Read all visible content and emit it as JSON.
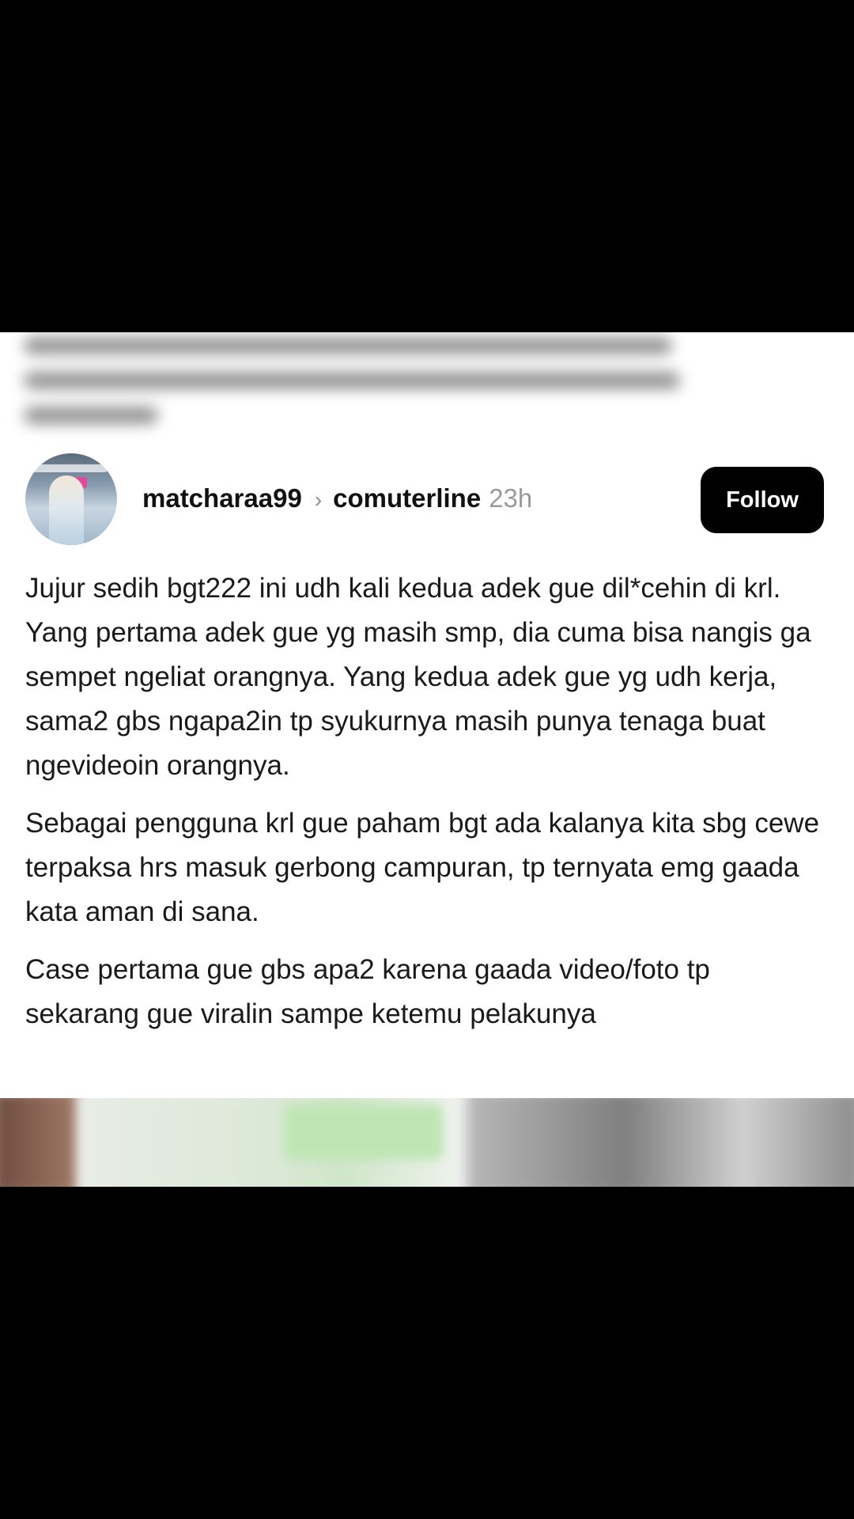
{
  "post": {
    "username": "matcharaa99",
    "separator": "›",
    "community": "comuterline",
    "time": "23h",
    "follow_label": "Follow",
    "paragraphs": [
      "Jujur sedih bgt222 ini udh kali kedua adek gue dil*cehin di krl. Yang pertama adek gue yg masih smp, dia cuma bisa nangis ga sempet ngeliat orangnya. Yang kedua adek gue yg udh kerja, sama2 gbs ngapa2in tp syukurnya masih punya tenaga buat ngevideoin orangnya.",
      "Sebagai pengguna krl gue paham bgt ada kalanya kita sbg cewe terpaksa hrs masuk gerbong campuran, tp ternyata emg gaada kata aman di sana.",
      "Case pertama gue gbs apa2 karena gaada video/foto tp sekarang gue viralin sampe ketemu pelakunya"
    ]
  },
  "colors": {
    "background": "#000000",
    "card": "#ffffff",
    "text": "#1a1a1a",
    "muted": "#9a9a9a",
    "button": "#000000",
    "button_text": "#ffffff"
  },
  "icons": {
    "avatar": "user-avatar-photo",
    "separator": "chevron-right-icon"
  }
}
